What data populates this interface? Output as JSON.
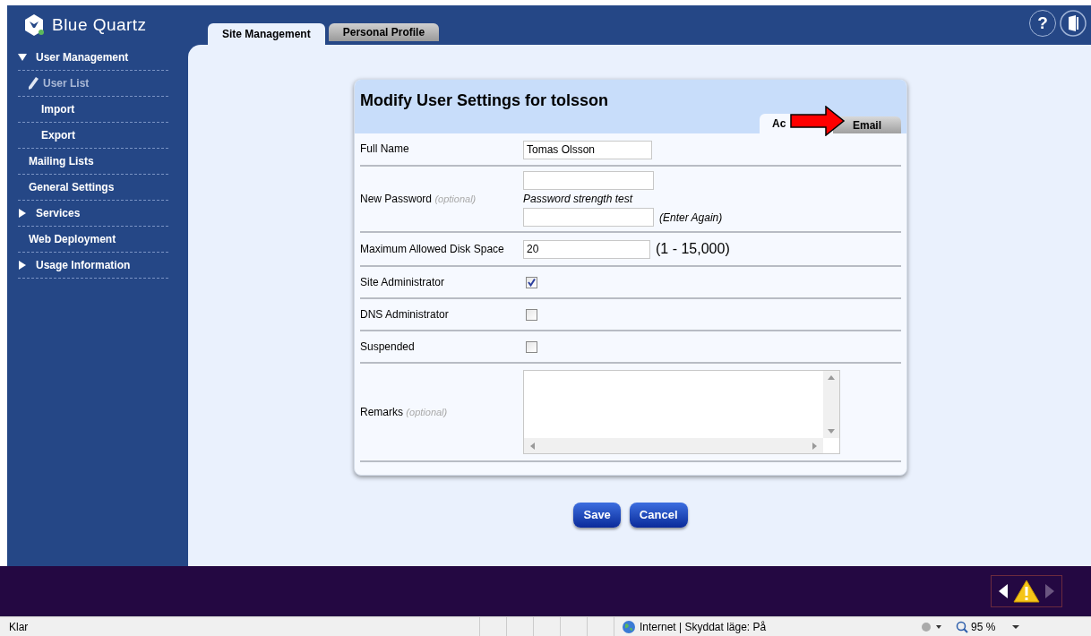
{
  "brand": "Blue Quartz",
  "help_icon": "?",
  "top_tabs": [
    {
      "label": "Site Management",
      "selected": true
    },
    {
      "label": "Personal Profile",
      "selected": false
    }
  ],
  "sidebar": {
    "items": [
      {
        "kind": "group",
        "label": "User Management",
        "expanded": true,
        "selected": false,
        "children": [
          {
            "label": "User List",
            "selected": true
          },
          {
            "label": "Import",
            "selected": false
          },
          {
            "label": "Export",
            "selected": false
          }
        ]
      },
      {
        "kind": "link",
        "label": "Mailing Lists",
        "selected": false
      },
      {
        "kind": "link",
        "label": "General Settings",
        "selected": false
      },
      {
        "kind": "group",
        "label": "Services",
        "expanded": false,
        "selected": false
      },
      {
        "kind": "link",
        "label": "Web Deployment",
        "selected": false
      },
      {
        "kind": "group",
        "label": "Usage Information",
        "expanded": false,
        "selected": false
      }
    ]
  },
  "form": {
    "title": "Modify User Settings for tolsson",
    "tabs": [
      {
        "label": "Ac",
        "selected": true
      },
      {
        "label": "Email",
        "selected": false
      }
    ],
    "rows": [
      {
        "kind": "text",
        "label": "Full Name",
        "value": "Tomas Olsson"
      },
      {
        "kind": "password",
        "label": "New Password",
        "hint": "(optional)",
        "strength": "Password strength test",
        "again": "(Enter Again)"
      },
      {
        "kind": "number",
        "label": "Maximum Allowed Disk Space",
        "value": "20",
        "range": "(1 - 15,000)"
      },
      {
        "kind": "checkbox",
        "label": "Site Administrator",
        "checked": true
      },
      {
        "kind": "checkbox",
        "label": "DNS Administrator",
        "checked": false
      },
      {
        "kind": "checkbox",
        "label": "Suspended",
        "checked": false
      },
      {
        "kind": "textarea",
        "label": "Remarks",
        "hint": "(optional)"
      }
    ]
  },
  "buttons": [
    "Save",
    "Cancel"
  ],
  "status_bar": {
    "status": "Klar",
    "zone": "Internet | Skyddat läge: På",
    "zoom": "95 %"
  }
}
